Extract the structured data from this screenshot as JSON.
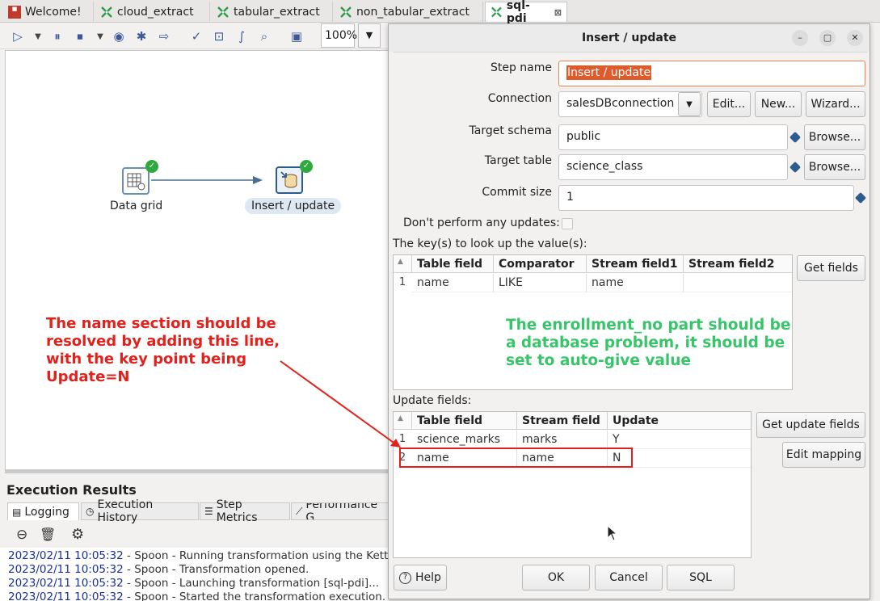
{
  "tabs": [
    {
      "label": "Welcome!",
      "icon": "welcome-icon"
    },
    {
      "label": "cloud_extract",
      "icon": "transformation-icon"
    },
    {
      "label": "tabular_extract",
      "icon": "transformation-icon"
    },
    {
      "label": "non_tabular_extract",
      "icon": "transformation-icon"
    },
    {
      "label": "sql-pdi",
      "icon": "transformation-icon",
      "active": true
    }
  ],
  "toolbar": {
    "zoom": "100%"
  },
  "canvas": {
    "nodes": [
      {
        "label": "Data grid",
        "icon": "data-grid-icon",
        "status": "ok"
      },
      {
        "label": "Insert / update",
        "icon": "insert-update-icon",
        "status": "ok",
        "selected": true
      }
    ]
  },
  "execution": {
    "title": "Execution Results",
    "tabs": [
      "Logging",
      "Execution History",
      "Step Metrics",
      "Performance G"
    ],
    "log": [
      {
        "ts": "2023/02/11 10:05:32",
        "msg": " - Spoon - Running transformation using the Kettle e"
      },
      {
        "ts": "2023/02/11 10:05:32",
        "msg": " - Spoon - Transformation opened."
      },
      {
        "ts": "2023/02/11 10:05:32",
        "msg": " - Spoon - Launching transformation [sql-pdi]..."
      },
      {
        "ts": "2023/02/11 10:05:32",
        "msg": " - Spoon - Started the transformation execution."
      }
    ]
  },
  "dialog": {
    "title": "Insert / update",
    "step_name_label": "Step name",
    "step_name": "Insert / update",
    "connection_label": "Connection",
    "connection": "salesDBconnection",
    "edit_btn": "Edit...",
    "new_btn": "New...",
    "wizard_btn": "Wizard...",
    "schema_label": "Target schema",
    "schema": "public",
    "browse_btn": "Browse...",
    "table_label": "Target table",
    "table": "science_class",
    "commit_label": "Commit size",
    "commit": "1",
    "no_update_label": "Don't perform any updates:",
    "keys_label": "The key(s) to look up the value(s):",
    "keys_headers": [
      "Table field",
      "Comparator",
      "Stream field1",
      "Stream field2"
    ],
    "keys_rows": [
      [
        "1",
        "name",
        "LIKE",
        "name",
        ""
      ]
    ],
    "get_fields_btn": "Get fields",
    "update_label": "Update fields:",
    "update_headers": [
      "Table field",
      "Stream field",
      "Update"
    ],
    "update_rows": [
      [
        "1",
        "science_marks",
        "marks",
        "Y"
      ],
      [
        "2",
        "name",
        "name",
        "N"
      ]
    ],
    "get_update_btn": "Get update fields",
    "edit_mapping_btn": "Edit mapping",
    "help_btn": "Help",
    "ok_btn": "OK",
    "cancel_btn": "Cancel",
    "sql_btn": "SQL"
  },
  "annotations": {
    "red": [
      "The name section should be",
      "resolved by adding this line,",
      "with the key point being",
      "Update=N"
    ],
    "green": [
      "The enrollment_no part should be",
      "a database problem, it should be",
      "set to auto-give value"
    ]
  },
  "colors": {
    "annotation_red": "#e3211c",
    "annotation_green": "#38c56a",
    "ok_check": "#2eaa3d",
    "highlight": "#e3211c"
  }
}
